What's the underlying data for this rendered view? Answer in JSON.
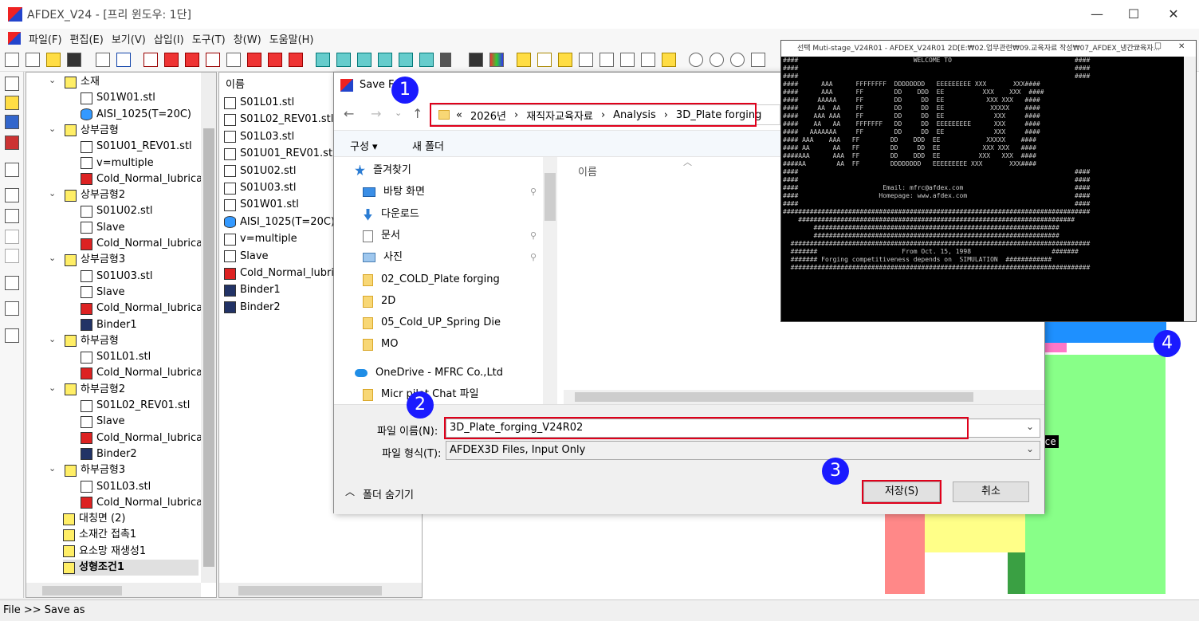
{
  "app": {
    "title": "AFDEX_V24 - [프리 윈도우: 1단]"
  },
  "menu": [
    "파일(F)",
    "편집(E)",
    "보기(V)",
    "삽입(I)",
    "도구(T)",
    "창(W)",
    "도움말(H)"
  ],
  "tree": {
    "items": [
      {
        "label": "소재",
        "level": 1
      },
      {
        "label": "S01W01.stl",
        "level": 2
      },
      {
        "label": "AISI_1025(T=20C)",
        "level": 2
      },
      {
        "label": "상부금형",
        "level": 1
      },
      {
        "label": "S01U01_REV01.stl",
        "level": 2
      },
      {
        "label": "v=multiple",
        "level": 2
      },
      {
        "label": "Cold_Normal_lubricat",
        "level": 2
      },
      {
        "label": "상부금형2",
        "level": 1
      },
      {
        "label": "S01U02.stl",
        "level": 2
      },
      {
        "label": "Slave",
        "level": 2
      },
      {
        "label": "Cold_Normal_lubricat",
        "level": 2
      },
      {
        "label": "상부금형3",
        "level": 1
      },
      {
        "label": "S01U03.stl",
        "level": 2
      },
      {
        "label": "Slave",
        "level": 2
      },
      {
        "label": "Cold_Normal_lubricat",
        "level": 2
      },
      {
        "label": "Binder1",
        "level": 2
      },
      {
        "label": "하부금형",
        "level": 1
      },
      {
        "label": "S01L01.stl",
        "level": 2
      },
      {
        "label": "Cold_Normal_lubricat",
        "level": 2
      },
      {
        "label": "하부금형2",
        "level": 1
      },
      {
        "label": "S01L02_REV01.stl",
        "level": 2
      },
      {
        "label": "Slave",
        "level": 2
      },
      {
        "label": "Cold_Normal_lubricat",
        "level": 2
      },
      {
        "label": "Binder2",
        "level": 2
      },
      {
        "label": "하부금형3",
        "level": 1
      },
      {
        "label": "S01L03.stl",
        "level": 2
      },
      {
        "label": "Cold_Normal_lubricat",
        "level": 2
      },
      {
        "label": "대칭면 (2)",
        "level": 0
      },
      {
        "label": "소재간 접촉1",
        "level": 0
      },
      {
        "label": "요소망 재생성1",
        "level": 0
      },
      {
        "label": "성형조건1",
        "level": 0
      }
    ]
  },
  "list": {
    "header": "이름",
    "items": [
      "S01L01.stl",
      "S01L02_REV01.stl",
      "S01L03.stl",
      "S01U01_REV01.stl",
      "S01U02.stl",
      "S01U03.stl",
      "S01W01.stl",
      "AISI_1025(T=20C)",
      "v=multiple",
      "Slave",
      "Cold_Normal_lubrica",
      "Binder1",
      "Binder2"
    ]
  },
  "dialog": {
    "title": "Save F",
    "path": [
      "«",
      "2026년",
      "›",
      "재직자교육자료",
      "›",
      "Analysis",
      "›",
      "3D_Plate forging"
    ],
    "organize": "구성 ▾",
    "new_folder": "새 폴더",
    "nav": [
      {
        "label": "즐겨찾기"
      },
      {
        "label": "바탕 화면"
      },
      {
        "label": "다운로드"
      },
      {
        "label": "문서"
      },
      {
        "label": "사진"
      },
      {
        "label": "02_COLD_Plate forging"
      },
      {
        "label": "2D"
      },
      {
        "label": "05_Cold_UP_Spring Die"
      },
      {
        "label": "MO"
      },
      {
        "label": "OneDrive - MFRC Co.,Ltd"
      },
      {
        "label": "Micr        pilot Chat 파일"
      }
    ],
    "files_header": "이름",
    "filename_label": "파일 이름(N):",
    "filename_value": "3D_Plate_forging_V24R02",
    "filetype_label": "파일 형식(T):",
    "filetype_value": "AFDEX3D Files, Input Only",
    "hide_folders": "폴더 숨기기",
    "save": "저장(S)",
    "cancel": "취소"
  },
  "console": {
    "title": "선택 Muti-stage_V24R01 - AFDEX_V24R01 2D[E:₩02.업무관련₩09.교육자료 작성₩07_AFDEX_냉간교육자...",
    "lines": [
      "####                              WELCOME TO                                ####",
      "####                                                                        ####",
      "####                                                                        ####",
      "####      AAA      FFFFFFFF  DDDDDDDD   EEEEEEEEE XXX       XXX####",
      "####      AAA      FF        DD    DDD  EE          XXX    XXX  ####",
      "####     AAAAA     FF        DD     DD  EE           XXX XXX   ####",
      "####     AA  AA    FF        DD     DD  EE            XXXXX    ####",
      "####    AAA AAA    FF        DD     DD  EE             XXX     ####",
      "####    AA   AA    FFFFFFF   DD     DD  EEEEEEEEE      XXX     ####",
      "####   AAAAAAA     FF        DD     DD  EE             XXX     ####",
      "#### AAA    AAA   FF        DD    DDD  EE            XXXXX    ####",
      "#### AA      AA   FF        DD     DD  EE           XXX XXX   ####",
      "####AAA      AAA  FF        DD    DDD  EE          XXX   XXX  ####",
      "####AA        AA  FF        DDDDDDDD   EEEEEEEEE XXX       XXX####",
      "####                                                                        ####",
      "####                                                                        ####",
      "####                      Email: mfrc@afdex.com                             ####",
      "####                     Homepage: www.afdex.com                            ####",
      "####                                                                        ####",
      "################################################################################",
      "    ########################################################################",
      "        ################################################################",
      "        ################################################################",
      "",
      "  ##############################################################################",
      "  #######                      From Oct. 15, 1998                     #######",
      "  ####### Forging competitiveness depends on  SIMULATION  ############",
      "  ##############################################################################"
    ]
  },
  "viewport": {
    "label": "nce"
  },
  "badges": [
    "1",
    "2",
    "3",
    "4"
  ],
  "status": "File >> Save as"
}
